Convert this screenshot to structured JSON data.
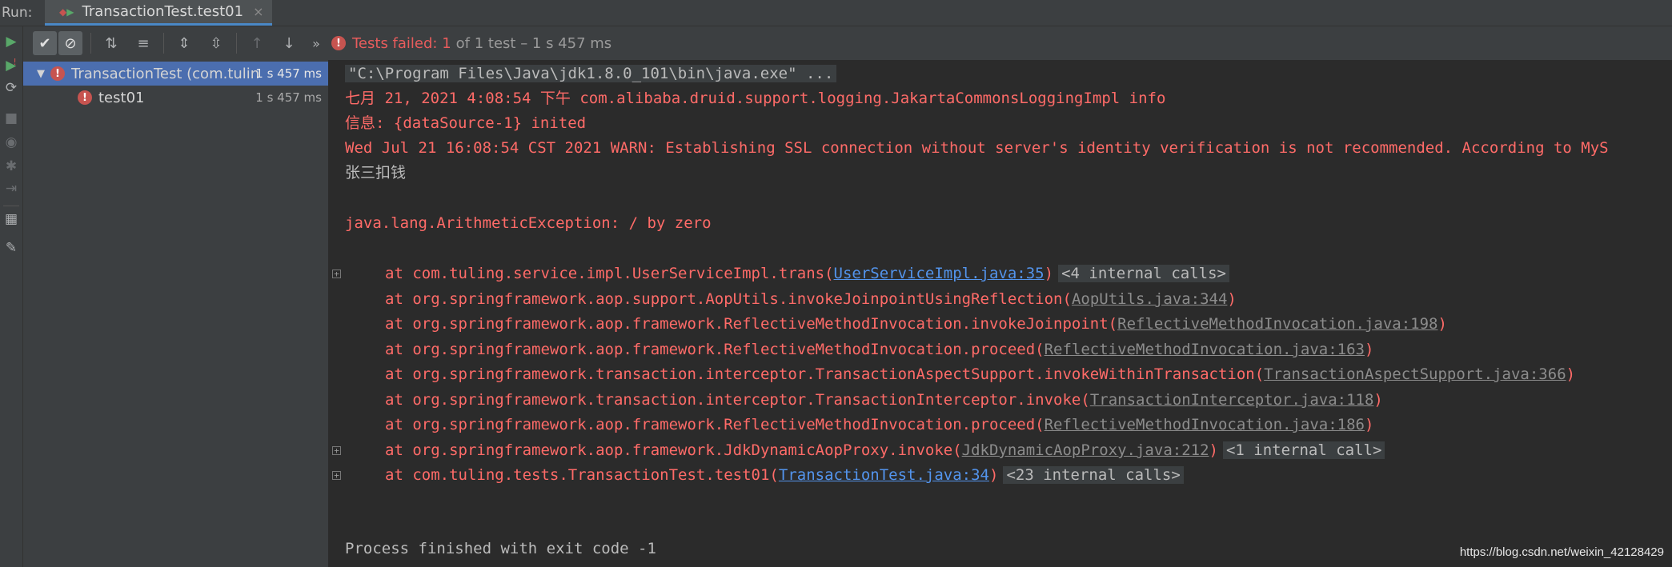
{
  "runbar": {
    "label": "Run:",
    "tab_title": "TransactionTest.test01",
    "tab_close": "×"
  },
  "left_tools": [
    {
      "name": "rerun-icon",
      "glyph": "▶",
      "color": "#59a869"
    },
    {
      "name": "rerun-failed-icon",
      "glyph": "▶",
      "color": "#59a869"
    },
    {
      "name": "toggle-auto-test-icon",
      "glyph": "⟳",
      "color": "#afb1b3"
    },
    {
      "name": "stop-icon",
      "glyph": "■",
      "color": "#6a6d70"
    },
    {
      "name": "camera-icon",
      "glyph": "◉",
      "color": "#6a6d70"
    },
    {
      "name": "debug-icon",
      "glyph": "✱",
      "color": "#6a6d70"
    },
    {
      "name": "exit-icon",
      "glyph": "⇥",
      "color": "#6a6d70"
    },
    {
      "name": "layout-icon",
      "glyph": "▦",
      "color": "#afb1b3"
    },
    {
      "name": "pin-icon",
      "glyph": "✎",
      "color": "#afb1b3"
    }
  ],
  "testbar": {
    "status_icon": "!",
    "status_fail": "Tests failed: 1",
    "status_rest": "of 1 test – 1 s 457 ms",
    "more": "»"
  },
  "tree": {
    "root_name": "TransactionTest (com.tulin",
    "root_time": "1 s 457 ms",
    "child_name": "test01",
    "child_time": "1 s 457 ms"
  },
  "console": {
    "cmd": "\"C:\\Program Files\\Java\\jdk1.8.0_101\\bin\\java.exe\" ...",
    "log1": "七月 21, 2021 4:08:54 下午 com.alibaba.druid.support.logging.JakartaCommonsLoggingImpl info",
    "log2": "信息: {dataSource-1} inited",
    "log3": "Wed Jul 21 16:08:54 CST 2021 WARN: Establishing SSL connection without server's identity verification is not recommended. According to MyS",
    "out1": "张三扣钱",
    "exception": "java.lang.ArithmeticException: / by zero",
    "trace": [
      {
        "prefix": "at com.tuling.service.impl.UserServiceImpl.trans(",
        "link": "UserServiceImpl.java:35",
        "suffix": ")",
        "internal": "<4 internal calls>",
        "primary": true,
        "fold": true
      },
      {
        "prefix": "at org.springframework.aop.support.AopUtils.invokeJoinpointUsingReflection(",
        "link": "AopUtils.java:344",
        "suffix": ")",
        "internal": "",
        "primary": false,
        "fold": false
      },
      {
        "prefix": "at org.springframework.aop.framework.ReflectiveMethodInvocation.invokeJoinpoint(",
        "link": "ReflectiveMethodInvocation.java:198",
        "suffix": ")",
        "internal": "",
        "primary": false,
        "fold": false
      },
      {
        "prefix": "at org.springframework.aop.framework.ReflectiveMethodInvocation.proceed(",
        "link": "ReflectiveMethodInvocation.java:163",
        "suffix": ")",
        "internal": "",
        "primary": false,
        "fold": false
      },
      {
        "prefix": "at org.springframework.transaction.interceptor.TransactionAspectSupport.invokeWithinTransaction(",
        "link": "TransactionAspectSupport.java:366",
        "suffix": ")",
        "internal": "",
        "primary": false,
        "fold": false
      },
      {
        "prefix": "at org.springframework.transaction.interceptor.TransactionInterceptor.invoke(",
        "link": "TransactionInterceptor.java:118",
        "suffix": ")",
        "internal": "",
        "primary": false,
        "fold": false
      },
      {
        "prefix": "at org.springframework.aop.framework.ReflectiveMethodInvocation.proceed(",
        "link": "ReflectiveMethodInvocation.java:186",
        "suffix": ")",
        "internal": "",
        "primary": false,
        "fold": false
      },
      {
        "prefix": "at org.springframework.aop.framework.JdkDynamicAopProxy.invoke(",
        "link": "JdkDynamicAopProxy.java:212",
        "suffix": ")",
        "internal": "<1 internal call>",
        "primary": false,
        "fold": true
      },
      {
        "prefix": "at com.tuling.tests.TransactionTest.test01(",
        "link": "TransactionTest.java:34",
        "suffix": ")",
        "internal": "<23 internal calls>",
        "primary": true,
        "fold": true
      }
    ],
    "exit": "Process finished with exit code -1"
  },
  "watermark": "https://blog.csdn.net/weixin_42128429"
}
